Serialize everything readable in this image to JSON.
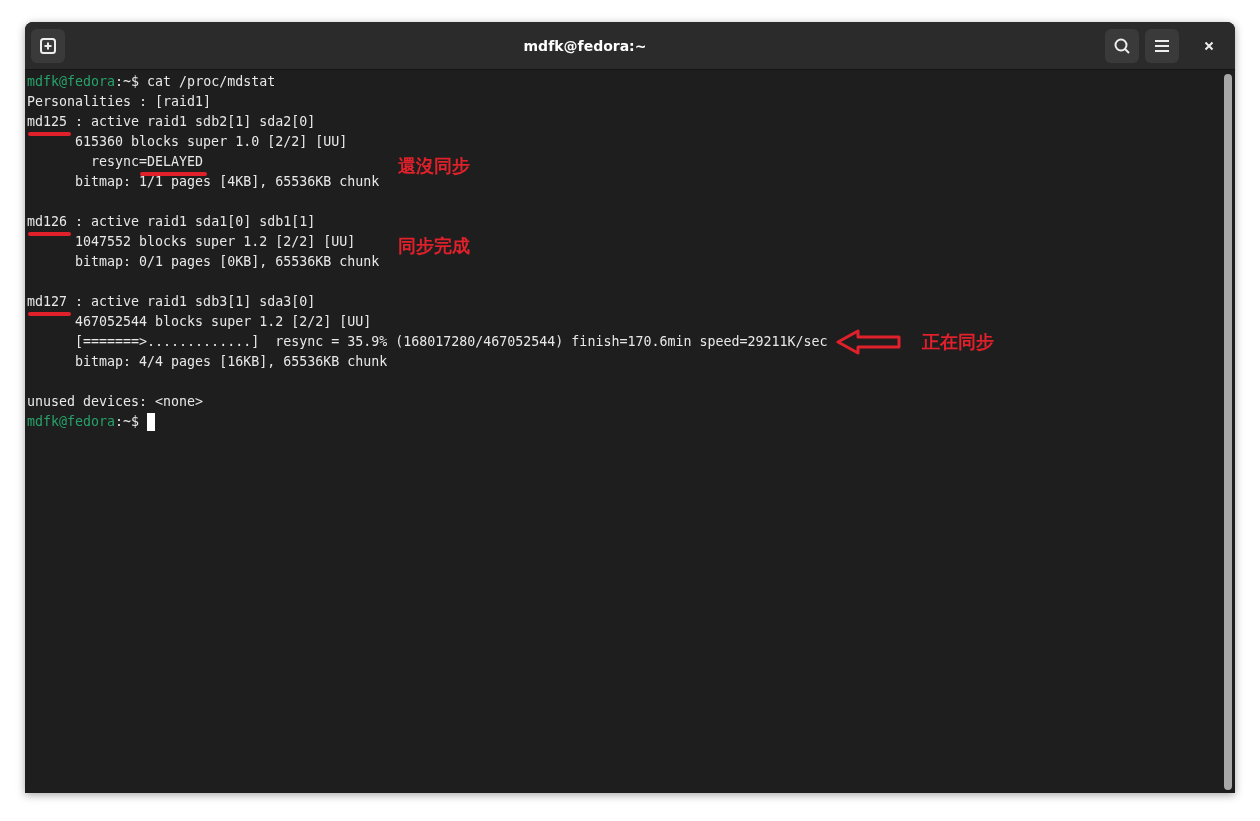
{
  "window": {
    "title": "mdfk@fedora:~"
  },
  "terminal": {
    "lines": [
      {
        "kind": "prompt",
        "user": "mdfk@fedora",
        "path": ":~$",
        "command": "cat /proc/mdstat",
        "cursor": false
      },
      {
        "kind": "output",
        "segments": [
          {
            "text": "Personalities : [raid1]",
            "underlined": false
          }
        ]
      },
      {
        "kind": "output",
        "segments": [
          {
            "text": "md125",
            "underlined": true
          },
          {
            "text": " : active raid1 sdb2[1] sda2[0]",
            "underlined": false
          }
        ]
      },
      {
        "kind": "output",
        "segments": [
          {
            "text": "      615360 blocks super 1.0 [2/2] [UU]",
            "underlined": false
          }
        ]
      },
      {
        "kind": "output",
        "segments": [
          {
            "text": "        resync",
            "underlined": false
          },
          {
            "text": "=DELAYED",
            "underlined": true
          }
        ],
        "note": {
          "text": "還沒同步",
          "arrow": false
        }
      },
      {
        "kind": "output",
        "segments": [
          {
            "text": "      bitmap: 1/1 pages [4KB], 65536KB chunk",
            "underlined": false
          }
        ]
      },
      {
        "kind": "blank"
      },
      {
        "kind": "output",
        "segments": [
          {
            "text": "md126",
            "underlined": true
          },
          {
            "text": " : active raid1 sda1[0] sdb1[1]",
            "underlined": false
          }
        ]
      },
      {
        "kind": "output",
        "segments": [
          {
            "text": "      1047552 blocks super 1.2 [2/2] [UU]",
            "underlined": false
          }
        ],
        "note": {
          "text": "同步完成",
          "arrow": false
        }
      },
      {
        "kind": "output",
        "segments": [
          {
            "text": "      bitmap: 0/1 pages [0KB], 65536KB chunk",
            "underlined": false
          }
        ]
      },
      {
        "kind": "blank"
      },
      {
        "kind": "output",
        "segments": [
          {
            "text": "md127",
            "underlined": true
          },
          {
            "text": " : active raid1 sdb3[1] sda3[0]",
            "underlined": false
          }
        ]
      },
      {
        "kind": "output",
        "segments": [
          {
            "text": "      467052544 blocks super 1.2 [2/2] [UU]",
            "underlined": false
          }
        ]
      },
      {
        "kind": "output",
        "segments": [
          {
            "text": "      [=======>.............]  resync = 35.9% (168017280/467052544) finish=170.6min speed=29211K/sec",
            "underlined": false
          }
        ],
        "note": {
          "text": "正在同步",
          "arrow": true
        }
      },
      {
        "kind": "output",
        "segments": [
          {
            "text": "      bitmap: 4/4 pages [16KB], 65536KB chunk",
            "underlined": false
          }
        ]
      },
      {
        "kind": "blank"
      },
      {
        "kind": "output",
        "segments": [
          {
            "text": "unused devices: <none>",
            "underlined": false
          }
        ]
      },
      {
        "kind": "prompt",
        "user": "mdfk@fedora",
        "path": ":~$",
        "cursor": true
      }
    ]
  }
}
